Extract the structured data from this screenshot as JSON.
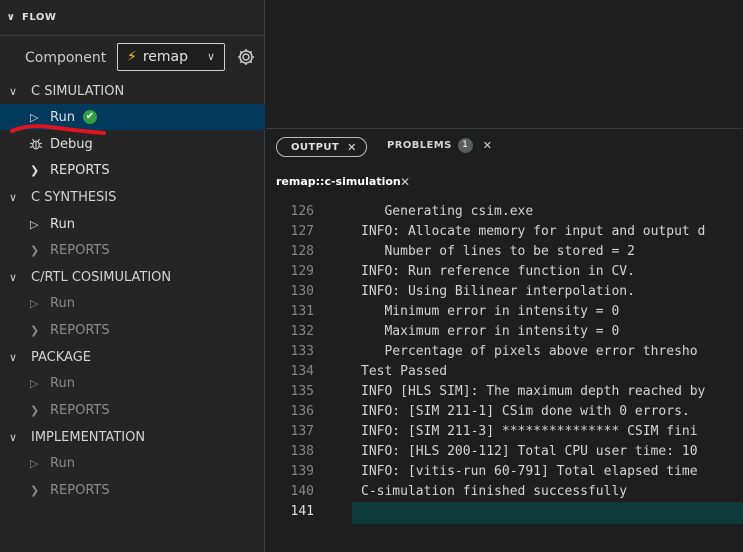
{
  "sidebar": {
    "header": "FLOW",
    "component_label": "Component",
    "component_value": "remap",
    "sections": [
      {
        "label": "C SIMULATION",
        "items": [
          {
            "label": "Run",
            "icon": "play-icon",
            "state": "selected",
            "status": "check"
          },
          {
            "label": "Debug",
            "icon": "bug-icon",
            "state": "enabled"
          },
          {
            "label": "REPORTS",
            "icon": "chevron-right-icon",
            "state": "enabled"
          }
        ]
      },
      {
        "label": "C SYNTHESIS",
        "items": [
          {
            "label": "Run",
            "icon": "play-icon",
            "state": "enabled"
          },
          {
            "label": "REPORTS",
            "icon": "chevron-right-icon",
            "state": "disabled"
          }
        ]
      },
      {
        "label": "C/RTL COSIMULATION",
        "items": [
          {
            "label": "Run",
            "icon": "play-icon",
            "state": "disabled"
          },
          {
            "label": "REPORTS",
            "icon": "chevron-right-icon",
            "state": "disabled"
          }
        ]
      },
      {
        "label": "PACKAGE",
        "items": [
          {
            "label": "Run",
            "icon": "play-icon",
            "state": "disabled"
          },
          {
            "label": "REPORTS",
            "icon": "chevron-right-icon",
            "state": "disabled"
          }
        ]
      },
      {
        "label": "IMPLEMENTATION",
        "items": [
          {
            "label": "Run",
            "icon": "play-icon",
            "state": "disabled"
          },
          {
            "label": "REPORTS",
            "icon": "chevron-right-icon",
            "state": "disabled"
          }
        ]
      }
    ]
  },
  "panel": {
    "output_tab": "OUTPUT",
    "problems_tab": "PROBLEMS",
    "problems_count": "1"
  },
  "editor": {
    "tab_title": "remap::c-simulation",
    "lines": [
      {
        "num": "126",
        "text": "   Generating csim.exe"
      },
      {
        "num": "127",
        "text": "INFO: Allocate memory for input and output d"
      },
      {
        "num": "128",
        "text": "   Number of lines to be stored = 2"
      },
      {
        "num": "129",
        "text": "INFO: Run reference function in CV."
      },
      {
        "num": "130",
        "text": "INFO: Using Bilinear interpolation."
      },
      {
        "num": "131",
        "text": "   Minimum error in intensity = 0"
      },
      {
        "num": "132",
        "text": "   Maximum error in intensity = 0"
      },
      {
        "num": "133",
        "text": "   Percentage of pixels above error thresho"
      },
      {
        "num": "134",
        "text": "Test Passed"
      },
      {
        "num": "135",
        "text": "INFO [HLS SIM]: The maximum depth reached by"
      },
      {
        "num": "136",
        "text": "INFO: [SIM 211-1] CSim done with 0 errors."
      },
      {
        "num": "137",
        "text": "INFO: [SIM 211-3] *************** CSIM fini"
      },
      {
        "num": "138",
        "text": "INFO: [HLS 200-112] Total CPU user time: 10"
      },
      {
        "num": "139",
        "text": "INFO: [vitis-run 60-791] Total elapsed time"
      },
      {
        "num": "140",
        "text": "C-simulation finished successfully"
      },
      {
        "num": "141",
        "text": ""
      }
    ]
  },
  "colors": {
    "accent_selected": "#04395e",
    "success": "#2ea043",
    "bolt": "#f5c518",
    "annotation": "#e0141e"
  }
}
